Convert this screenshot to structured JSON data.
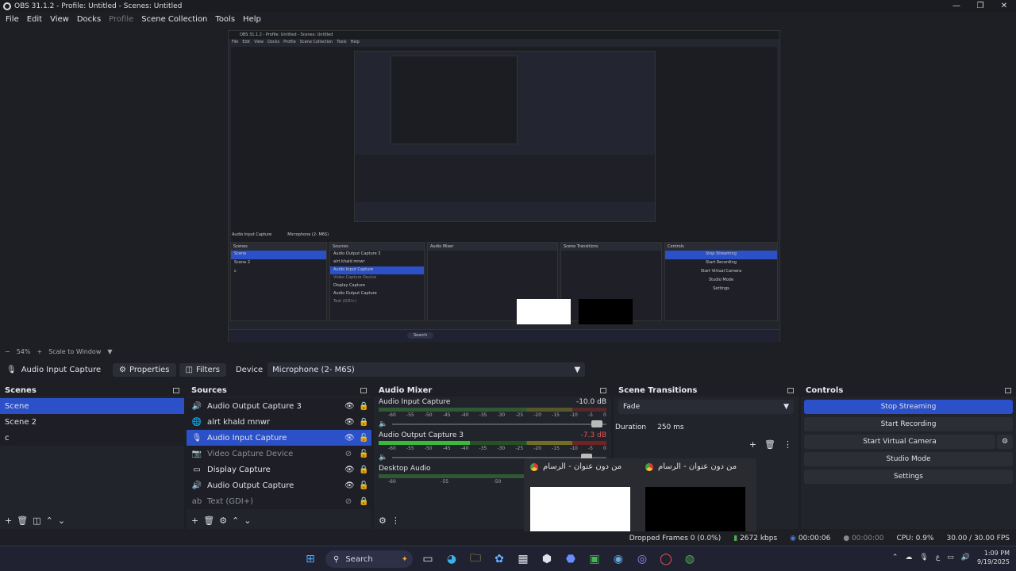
{
  "window": {
    "title": "OBS 31.1.2 - Profile: Untitled - Scenes: Untitled"
  },
  "menu": [
    "File",
    "Edit",
    "View",
    "Docks",
    "Profile",
    "Scene Collection",
    "Tools",
    "Help"
  ],
  "preview_bar": {
    "zoom": "54%",
    "scale_mode": "Scale to Window"
  },
  "device_bar": {
    "source_name": "Audio Input Capture",
    "properties": "Properties",
    "filters": "Filters",
    "device_label": "Device",
    "device_value": "Microphone (2- M6S)"
  },
  "scenes": {
    "title": "Scenes",
    "items": [
      "Scene",
      "Scene 2",
      "c"
    ],
    "selected": 0
  },
  "sources": {
    "title": "Sources",
    "items": [
      {
        "name": "Audio Output Capture 3",
        "icon": "speaker-icon",
        "dim": false
      },
      {
        "name": "alrt khald mnwr",
        "icon": "browser-icon",
        "dim": false
      },
      {
        "name": "Audio Input Capture",
        "icon": "mic-icon",
        "dim": false,
        "selected": true
      },
      {
        "name": "Video Capture Device",
        "icon": "camera-icon",
        "dim": true
      },
      {
        "name": "Display Capture",
        "icon": "monitor-icon",
        "dim": false
      },
      {
        "name": "Audio Output Capture",
        "icon": "speaker-icon",
        "dim": false
      },
      {
        "name": "Text (GDI+)",
        "icon": "text-icon",
        "dim": true
      }
    ]
  },
  "mixer": {
    "title": "Audio Mixer",
    "channels": [
      {
        "name": "Audio Input Capture",
        "db": "-10.0 dB",
        "level": 0.0,
        "fader": 0.93
      },
      {
        "name": "Audio Output Capture 3",
        "db": "-7.3 dB",
        "level": 0.4,
        "fader": 0.9
      },
      {
        "name": "Desktop Audio",
        "db": "",
        "level": 0.0,
        "fader": 0.85
      }
    ],
    "ticks": [
      "-60",
      "-55",
      "-50",
      "-45",
      "-40",
      "-35",
      "-30",
      "-25",
      "-20",
      "-15",
      "-10",
      "-5",
      "0"
    ]
  },
  "transitions": {
    "title": "Scene Transitions",
    "type": "Fade",
    "duration_label": "Duration",
    "duration_value": "250 ms"
  },
  "controls": {
    "title": "Controls",
    "buttons": [
      "Stop Streaming",
      "Start Recording",
      "Start Virtual Camera",
      "Studio Mode",
      "Settings"
    ]
  },
  "popups": [
    {
      "title": "من دون عنوان - الرسام"
    },
    {
      "title": "من دون عنوان - الرسام"
    }
  ],
  "status": {
    "dropped": "Dropped Frames 0 (0.0%)",
    "kbps": "2672 kbps",
    "stream_time": "00:00:06",
    "rec_time": "00:00:00",
    "cpu": "CPU: 0.9%",
    "fps": "30.00 / 30.00 FPS"
  },
  "taskbar": {
    "search": "Search",
    "time": "1:09 PM",
    "date": "9/19/2025"
  },
  "nested": {
    "title": "OBS 31.1.2 - Profile: Untitled - Scenes: Untitled",
    "menu": [
      "File",
      "Edit",
      "View",
      "Docks",
      "Profile",
      "Scene Collection",
      "Tools",
      "Help"
    ],
    "source_name": "Audio Input Capture",
    "device_value": "Microphone (2- M6S)",
    "scenes": [
      "Scene",
      "Scene 2",
      "c"
    ],
    "sources": [
      "Audio Output Capture 3",
      "alrt khald mnwr",
      "Audio Input Capture",
      "Video Capture Device",
      "Display Capture",
      "Audio Output Capture",
      "Text (GDI+)"
    ],
    "controls": [
      "Stop Streaming",
      "Start Recording",
      "Start Virtual Camera",
      "Studio Mode",
      "Settings"
    ],
    "search": "Search"
  }
}
